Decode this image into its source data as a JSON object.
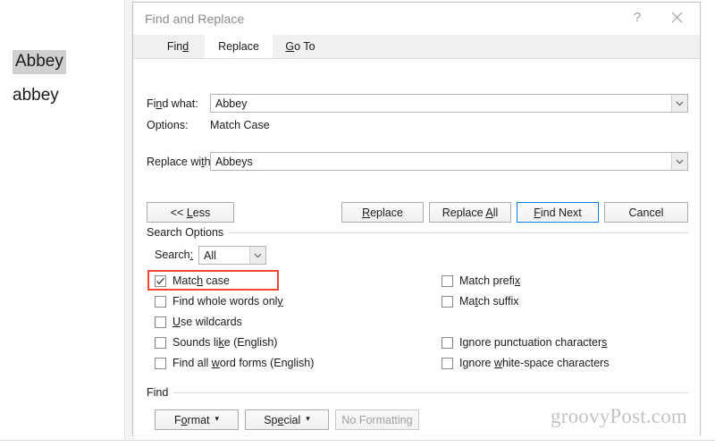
{
  "document": {
    "line1": "Abbey",
    "line2": "abbey"
  },
  "dialog": {
    "title": "Find and Replace",
    "help_label": "?",
    "close_label": "✕",
    "tabs": [
      {
        "label": "Find",
        "accel": "d",
        "active": false
      },
      {
        "label": "Replace",
        "accel": "",
        "active": true
      },
      {
        "label": "Go To",
        "accel": "G",
        "active": false
      }
    ],
    "fields": {
      "find_what_label": "Find what:",
      "find_what_value": "Abbey",
      "options_label": "Options:",
      "options_value": "Match Case",
      "replace_with_label": "Replace with:",
      "replace_with_value": "Abbeys"
    },
    "buttons": {
      "less": "<< Less",
      "replace": "Replace",
      "replace_all": "Replace All",
      "find_next": "Find Next",
      "cancel": "Cancel",
      "format": "Format",
      "special": "Special",
      "no_formatting": "No Formatting",
      "caret": "▾"
    },
    "search_options": {
      "group_label": "Search Options",
      "search_label": "Search:",
      "search_value": "All",
      "left_column": [
        {
          "label": "Match case",
          "checked": true
        },
        {
          "label": "Find whole words only",
          "checked": false
        },
        {
          "label": "Use wildcards",
          "checked": false
        },
        {
          "label": "Sounds like (English)",
          "checked": false
        },
        {
          "label": "Find all word forms (English)",
          "checked": false
        }
      ],
      "right_column": [
        {
          "label": "Match prefix",
          "checked": false
        },
        {
          "label": "Match suffix",
          "checked": false
        },
        {
          "label": "Ignore punctuation characters",
          "checked": false
        },
        {
          "label": "Ignore white-space characters",
          "checked": false
        }
      ]
    },
    "find_group": {
      "group_label": "Find"
    }
  },
  "annotation": {
    "color": "#f04a35",
    "target": "Match case"
  },
  "watermark": "groovyPost.com",
  "colors": {
    "accent_focus": "#0078d7",
    "annotation_red": "#f04a35",
    "selection_gray": "#d0d0d0",
    "dialog_bg": "#ffffff",
    "tabstrip_bg": "#f0f0f0"
  }
}
